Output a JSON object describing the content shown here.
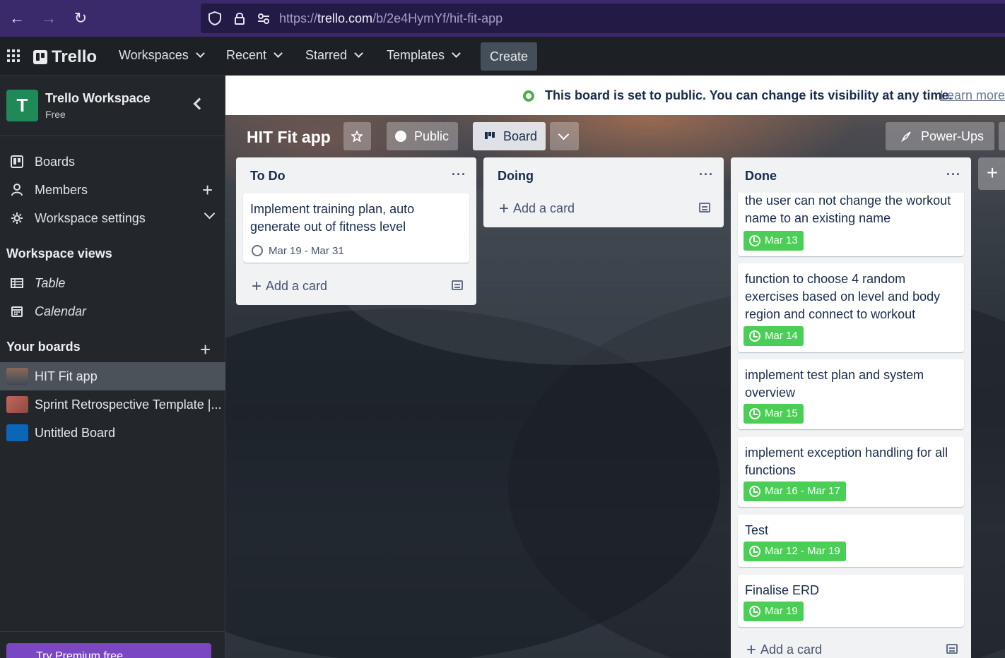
{
  "browser": {
    "url_prefix": "https://",
    "url_host": "trello.com",
    "url_path": "/b/2e4HymYf/hit-fit-app"
  },
  "header": {
    "logo": "Trello",
    "menus": [
      "Workspaces",
      "Recent",
      "Starred",
      "Templates"
    ],
    "create_label": "Create"
  },
  "sidebar": {
    "workspace_initial": "T",
    "workspace_name": "Trello Workspace",
    "workspace_plan": "Free",
    "nav": [
      {
        "label": "Boards",
        "icon": "board-icon"
      },
      {
        "label": "Members",
        "icon": "person-icon"
      },
      {
        "label": "Workspace settings",
        "icon": "gear-icon"
      }
    ],
    "views_heading": "Workspace views",
    "views": [
      {
        "label": "Table",
        "icon": "table-icon"
      },
      {
        "label": "Calendar",
        "icon": "calendar-icon"
      }
    ],
    "boards_heading": "Your boards",
    "boards": [
      {
        "label": "HIT Fit app",
        "color": "#3e4a56",
        "active": true
      },
      {
        "label": "Sprint Retrospective Template |...",
        "color": "#c0675a",
        "active": false
      },
      {
        "label": "Untitled Board",
        "color": "#0c66b8",
        "active": false
      }
    ],
    "premium_label": "Try Premium free"
  },
  "board": {
    "notice": "This board is set to public. You can change its visibility at any time.",
    "learn_more": "Learn more",
    "title": "HIT Fit app",
    "visibility": "Public",
    "view": "Board",
    "powerups": "Power-Ups",
    "add_card": "Add a card",
    "lists": [
      {
        "title": "To Do",
        "cards": [
          {
            "text": "Implement training plan, auto generate out of fitness level",
            "due": "Mar 19 - Mar 31",
            "complete": false
          }
        ]
      },
      {
        "title": "Doing",
        "cards": []
      },
      {
        "title": "Done",
        "cards": [
          {
            "text": "the user can not change the workout name to an existing name",
            "due": "Mar 13",
            "complete": true
          },
          {
            "text": "function to choose 4 random exercises based on level and body region and connect to workout",
            "due": "Mar 14",
            "complete": true
          },
          {
            "text": "implement test plan and system overview",
            "due": "Mar 15",
            "complete": true
          },
          {
            "text": "implement exception handling for all functions",
            "due": "Mar 16 - Mar 17",
            "complete": true
          },
          {
            "text": "Test",
            "due": "Mar 12 - Mar 19",
            "complete": true
          },
          {
            "text": "Finalise ERD",
            "due": "Mar 19",
            "complete": true
          }
        ]
      }
    ],
    "colors": {
      "due_complete": "#4bce55",
      "workspace_avatar": "#1f8a58",
      "browser_chrome": "#3a2a6b"
    }
  }
}
